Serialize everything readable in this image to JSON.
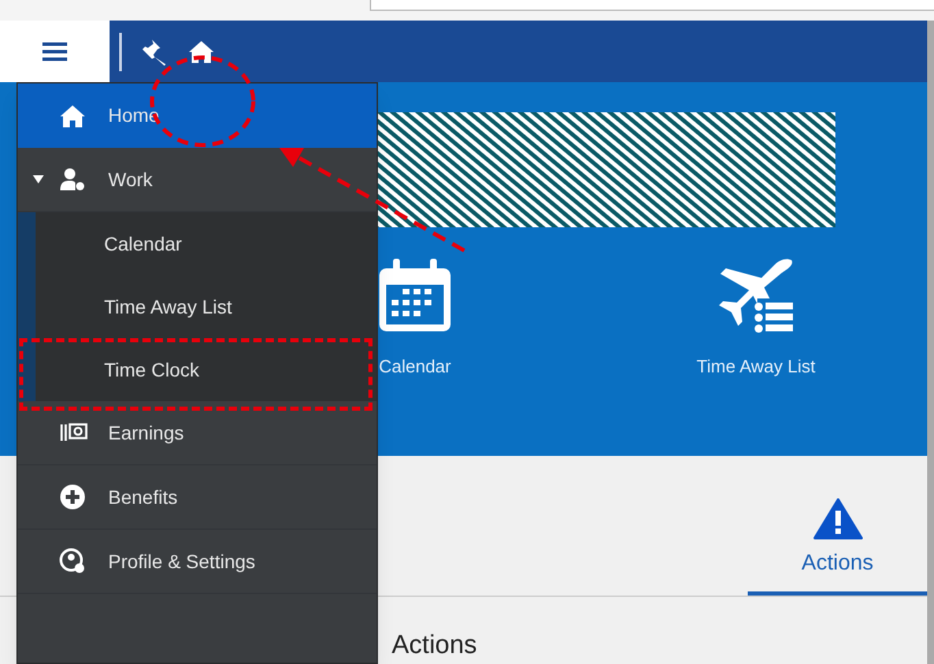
{
  "menu": {
    "items": [
      {
        "label": "Home",
        "kind": "link",
        "selected": true
      },
      {
        "label": "Work",
        "kind": "group",
        "selected": false,
        "expanded": true,
        "children": [
          {
            "label": "Calendar",
            "selected": false
          },
          {
            "label": "Time Away List",
            "selected": false
          },
          {
            "label": "Time Clock",
            "selected": false
          }
        ]
      },
      {
        "label": "Earnings",
        "kind": "link",
        "selected": false
      },
      {
        "label": "Benefits",
        "kind": "link",
        "selected": false
      },
      {
        "label": "Profile & Settings",
        "kind": "link",
        "selected": false
      }
    ]
  },
  "tiles": [
    {
      "label": "Calendar"
    },
    {
      "label": "Time Away List"
    }
  ],
  "tabs": [
    {
      "label": "Actions",
      "selected": true
    }
  ],
  "section_heading": "Actions"
}
